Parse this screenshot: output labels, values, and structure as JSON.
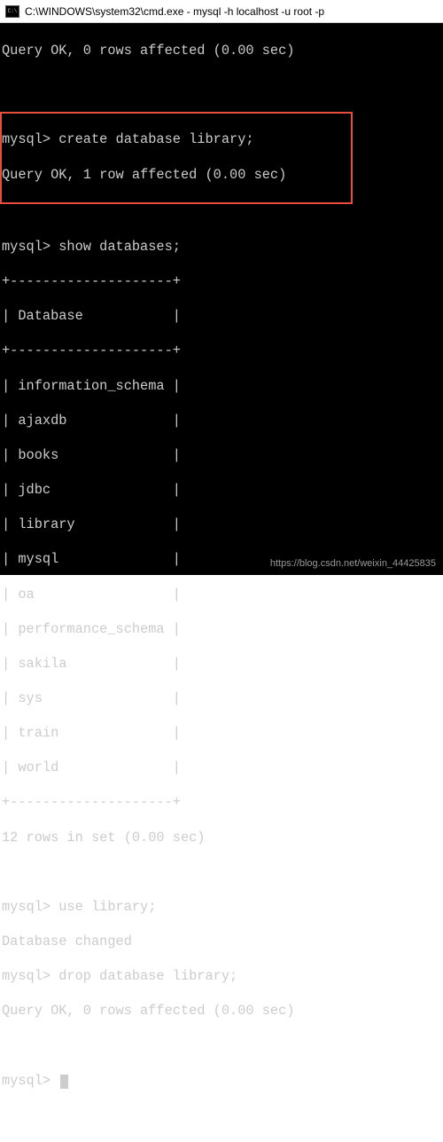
{
  "titlebar": {
    "text": "C:\\WINDOWS\\system32\\cmd.exe - mysql  -h localhost -u root -p"
  },
  "term": {
    "l1": "Query OK, 0 rows affected (0.00 sec)",
    "prompt": "mysql>",
    "cmd_create": " create database library;",
    "l_create_result": "Query OK, 1 row affected (0.00 sec)",
    "cmd_show": " show databases;",
    "border_top": "+--------------------+",
    "header": "| Database           |",
    "border_mid": "+--------------------+",
    "rows": [
      "| information_schema |",
      "| ajaxdb             |",
      "| books              |",
      "| jdbc               |",
      "| library            |",
      "| mysql              |",
      "| oa                 |",
      "| performance_schema |",
      "| sakila             |",
      "| sys                |",
      "| train              |",
      "| world              |"
    ],
    "border_bot": "+--------------------+",
    "rows_summary": "12 rows in set (0.00 sec)",
    "cmd_use": " use library;",
    "use_result": "Database changed",
    "cmd_drop": " drop database library;",
    "drop_result": "Query OK, 0 rows affected (0.00 sec)"
  },
  "watermark": "https://blog.csdn.net/weixin_44425835"
}
